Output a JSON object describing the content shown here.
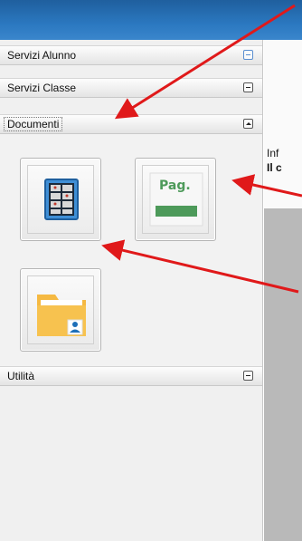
{
  "sidebar": {
    "sections": [
      {
        "label": "Servizi Alunno",
        "state": "collapsed",
        "toggle_icon": "minus-icon-blue"
      },
      {
        "label": "Servizi Classe",
        "state": "collapsed",
        "toggle_icon": "minus-icon"
      },
      {
        "label": "Documenti",
        "state": "expanded",
        "toggle_icon": "collapse-up-icon"
      },
      {
        "label": "Utilità",
        "state": "collapsed",
        "toggle_icon": "minus-icon"
      }
    ],
    "documenti_tiles": [
      {
        "icon": "calendar-grid-icon"
      },
      {
        "icon": "page-icon",
        "icon_text": "Pag."
      },
      {
        "icon": "user-folder-icon"
      }
    ]
  },
  "right_panel": {
    "line1": "Inf",
    "line2": "Il c"
  },
  "colors": {
    "header_blue": "#2b78c0",
    "arrow_red": "#e0191a",
    "page_icon_green": "#4d9a5a"
  }
}
